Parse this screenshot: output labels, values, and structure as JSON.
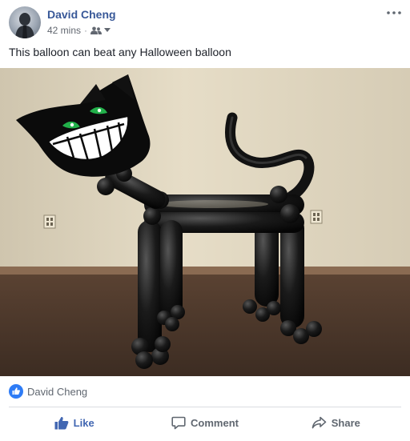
{
  "post": {
    "author_name": "David Cheng",
    "timestamp": "42 mins",
    "audience_icon": "friends-icon",
    "caption": "This balloon can beat any Halloween balloon"
  },
  "reactions": {
    "icon": "like-reaction-icon",
    "names": "David Cheng"
  },
  "actions": {
    "like_label": "Like",
    "comment_label": "Comment",
    "share_label": "Share"
  },
  "colors": {
    "author_link": "#385898",
    "like_active": "#4267b2",
    "muted_text": "#606770"
  }
}
